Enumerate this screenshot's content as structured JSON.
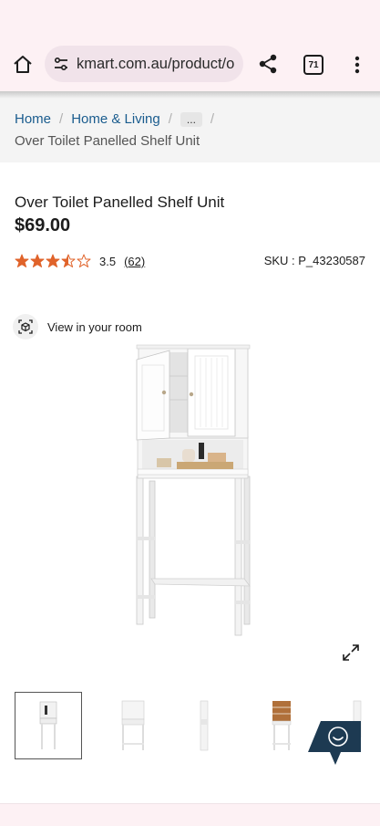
{
  "browser": {
    "url": "kmart.com.au/product/o",
    "tab_count": "71",
    "icons": [
      "home-icon",
      "tune-icon",
      "share-icon",
      "tabs-icon",
      "more-vert-icon"
    ]
  },
  "breadcrumb": {
    "items": [
      "Home",
      "Home & Living"
    ],
    "more": "...",
    "current": "Over Toilet Panelled Shelf Unit"
  },
  "product": {
    "title": "Over Toilet Panelled Shelf Unit",
    "price": "$69.00",
    "rating": "3.5",
    "rating_fraction": 0.7,
    "review_count": "(62)",
    "sku": "SKU : P_43230587"
  },
  "view_in_room": {
    "label": "View in your room",
    "icon": "ar-cube-icon"
  },
  "thumbnails": {
    "count": 5,
    "selected_index": 0
  },
  "colors": {
    "link": "#1a5c8e",
    "star": "#e0632a",
    "chrome_bg": "#fdf1f4",
    "chat_button": "#1d3a52"
  }
}
